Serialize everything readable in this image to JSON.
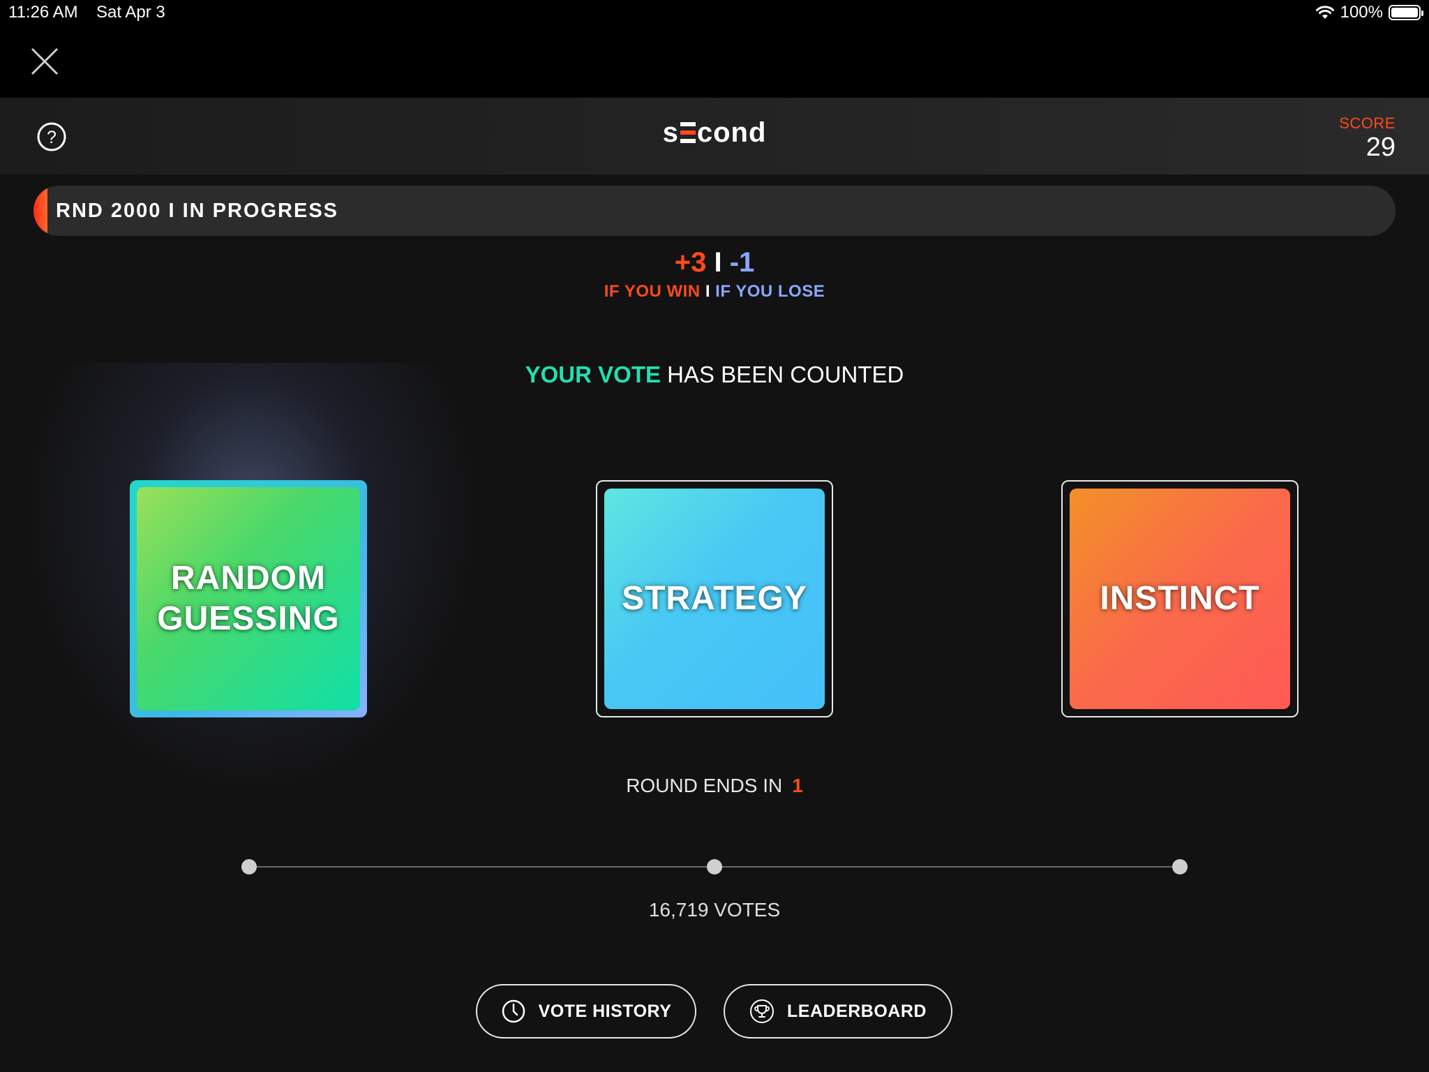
{
  "status_bar": {
    "time": "11:26 AM",
    "date": "Sat Apr 3",
    "battery": "100%"
  },
  "header": {
    "logo_left": "s",
    "logo_right": "cond",
    "score_label": "SCORE",
    "score_value": "29"
  },
  "round": {
    "label": "RND 2000 I IN PROGRESS",
    "progress": 0.01
  },
  "stakes": {
    "win_value": "+3",
    "separator": "I",
    "lose_value": "-1",
    "win_label": "IF YOU WIN",
    "lose_label": "IF YOU LOSE"
  },
  "vote_status": {
    "accent": "YOUR VOTE",
    "rest": " HAS BEEN COUNTED"
  },
  "options": [
    {
      "label": "RANDOM\nGUESSING",
      "selected": true
    },
    {
      "label": "STRATEGY",
      "selected": false
    },
    {
      "label": "INSTINCT",
      "selected": false
    }
  ],
  "round_ends": {
    "label": "ROUND ENDS IN",
    "value": "1"
  },
  "votes": "16,719 VOTES",
  "buttons": {
    "history": "VOTE HISTORY",
    "leaderboard": "LEADERBOARD"
  },
  "colors": {
    "accent": "#ff4a1c",
    "lose": "#8aa6ff",
    "vote": "#22e0b0"
  },
  "icons": {
    "close": "close-icon",
    "help": "help-icon",
    "wifi": "wifi-icon",
    "battery": "battery-icon",
    "clock": "clock-icon",
    "trophy": "trophy-icon"
  }
}
